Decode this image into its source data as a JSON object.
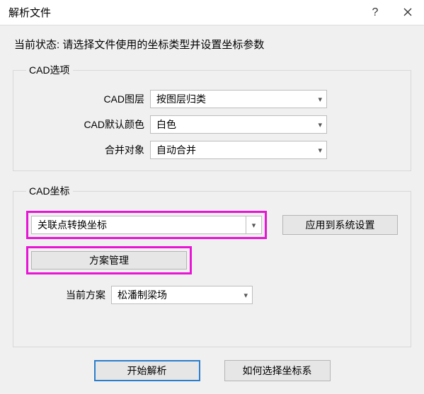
{
  "title": "解析文件",
  "status_line": "当前状态: 请选择文件使用的坐标类型并设置坐标参数",
  "groups": {
    "options": {
      "legend": "CAD选项",
      "rows": {
        "layer": {
          "label": "CAD图层",
          "value": "按图层归类"
        },
        "color": {
          "label": "CAD默认颜色",
          "value": "白色"
        },
        "merge": {
          "label": "合并对象",
          "value": "自动合并"
        }
      }
    },
    "coord": {
      "legend": "CAD坐标",
      "transform_value": "关联点转换坐标",
      "apply_label": "应用到系统设置",
      "scheme_manage_label": "方案管理",
      "current_scheme_label": "当前方案",
      "current_scheme_value": "松潘制梁场"
    }
  },
  "footer": {
    "start": "开始解析",
    "help": "如何选择坐标系"
  }
}
